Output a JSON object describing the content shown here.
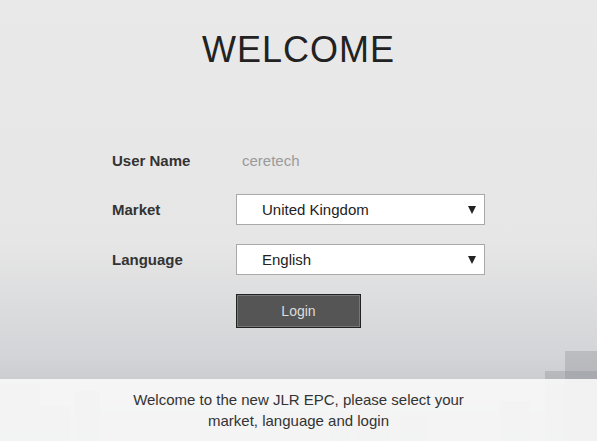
{
  "title": "WELCOME",
  "fields": [
    {
      "kind": "text",
      "label": "User Name",
      "value": "ceretech"
    },
    {
      "kind": "select",
      "label": "Market",
      "value": "United Kingdom"
    },
    {
      "kind": "select",
      "label": "Language",
      "value": "English"
    }
  ],
  "login_button": "Login",
  "footer": {
    "message": "Welcome to the new JLR EPC, please select your market, language and login"
  }
}
